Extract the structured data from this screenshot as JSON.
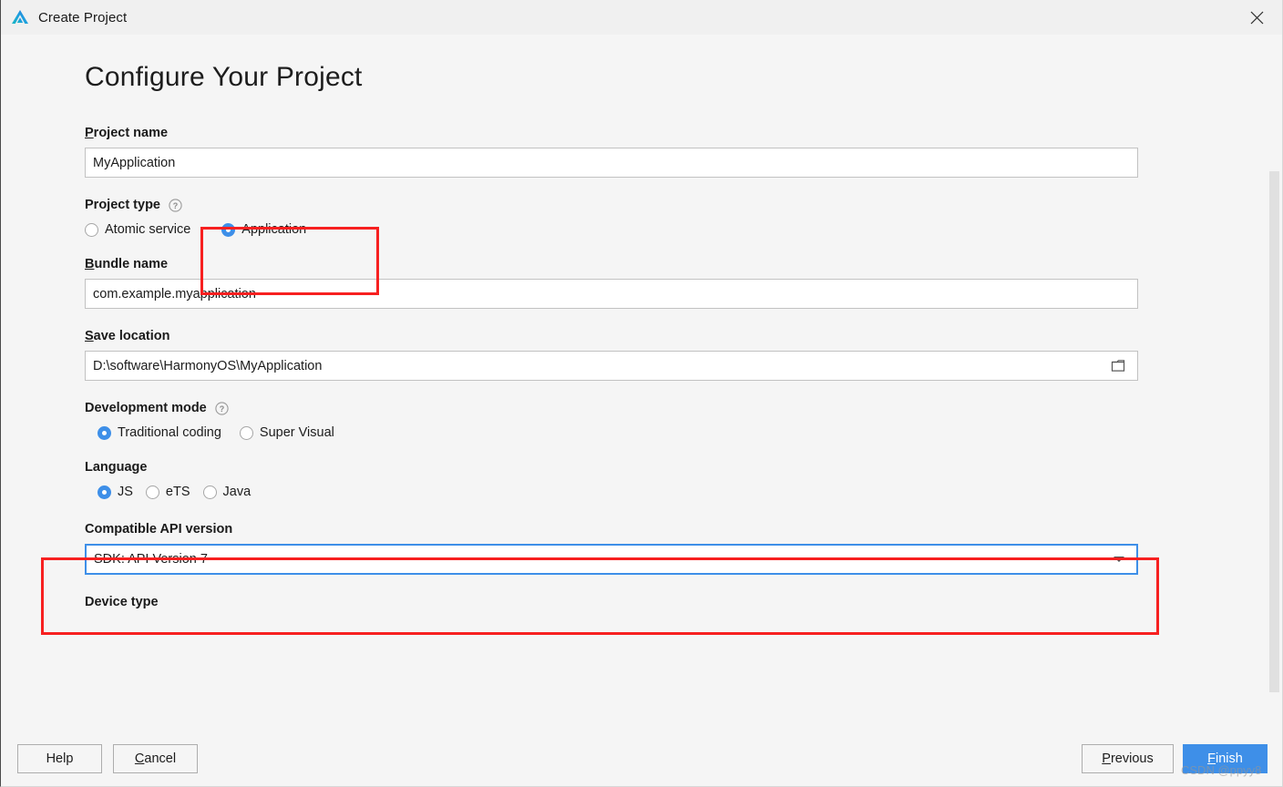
{
  "window": {
    "title": "Create Project",
    "logo_icon": "deveco-triangle-logo",
    "close_icon": "close-x-icon"
  },
  "page": {
    "heading": "Configure Your Project"
  },
  "fields": {
    "project_name": {
      "label_mnemonic": "P",
      "label_rest": "roject name",
      "value": "MyApplication"
    },
    "project_type": {
      "label": "Project type",
      "help_icon": "question-mark-icon",
      "options": [
        {
          "label": "Atomic service",
          "selected": false
        },
        {
          "label": "Application",
          "selected": true
        }
      ]
    },
    "bundle_name": {
      "label_mnemonic": "B",
      "label_rest": "undle name",
      "value": "com.example.myapplication"
    },
    "save_location": {
      "label_mnemonic": "S",
      "label_rest": "ave location",
      "value": "D:\\software\\HarmonyOS\\MyApplication",
      "browse_icon": "folder-icon"
    },
    "development_mode": {
      "label": "Development mode",
      "help_icon": "question-mark-icon",
      "options": [
        {
          "label": "Traditional coding",
          "selected": true
        },
        {
          "label": "Super Visual",
          "selected": false
        }
      ]
    },
    "language": {
      "label": "Language",
      "options": [
        {
          "label": "JS",
          "selected": true
        },
        {
          "label": "eTS",
          "selected": false
        },
        {
          "label": "Java",
          "selected": false
        }
      ]
    },
    "compatible_api_version": {
      "label": "Compatible API version",
      "value": "SDK: API Version 7",
      "arrow_icon": "chevron-down-icon"
    },
    "device_type": {
      "label": "Device type"
    }
  },
  "buttons": {
    "help": "Help",
    "cancel_mnemonic": "C",
    "cancel_rest": "ancel",
    "previous_mnemonic": "P",
    "previous_rest": "revious",
    "finish_mnemonic": "F",
    "finish_rest": "inish"
  },
  "watermark": "CSDN @ppyy8",
  "colors": {
    "accent": "#3e8fe8",
    "annotation": "#f72020",
    "titlebar_bg": "#f0f0f0",
    "body_bg": "#f5f5f5"
  }
}
